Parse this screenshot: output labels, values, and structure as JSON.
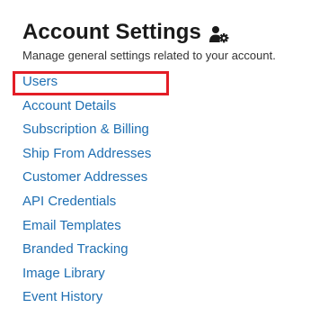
{
  "header": {
    "title": "Account Settings",
    "icon": "user-gear-icon",
    "subtitle": "Manage general settings related to your account."
  },
  "nav": {
    "items": [
      {
        "label": "Users",
        "selected": true
      },
      {
        "label": "Account Details"
      },
      {
        "label": "Subscription & Billing"
      },
      {
        "label": "Ship From Addresses"
      },
      {
        "label": "Customer Addresses"
      },
      {
        "label": "API Credentials"
      },
      {
        "label": "Email Templates"
      },
      {
        "label": "Branded Tracking"
      },
      {
        "label": "Image Library"
      },
      {
        "label": "Event History"
      }
    ]
  },
  "colors": {
    "link": "#1f6fb2",
    "highlight": "#e31d26",
    "title": "#1a1a1a"
  }
}
